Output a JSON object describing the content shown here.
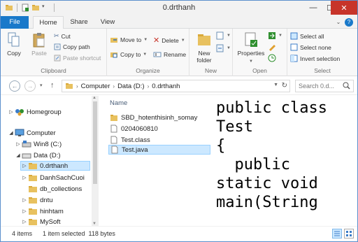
{
  "window": {
    "title": "0.drthanh"
  },
  "ribbon_tabs": [
    "File",
    "Home",
    "Share",
    "View"
  ],
  "clipboard": {
    "copy": "Copy",
    "paste": "Paste",
    "cut": "Cut",
    "copy_path": "Copy path",
    "paste_shortcut": "Paste shortcut",
    "label": "Clipboard"
  },
  "organize": {
    "move_to": "Move to",
    "copy_to": "Copy to",
    "delete": "Delete",
    "rename": "Rename",
    "label": "Organize"
  },
  "new_group": {
    "new_folder_line1": "New",
    "new_folder_line2": "folder",
    "label": "New"
  },
  "open_group": {
    "properties": "Properties",
    "label": "Open"
  },
  "select_group": {
    "select_all": "Select all",
    "select_none": "Select none",
    "invert_selection": "Invert selection",
    "label": "Select"
  },
  "address": {
    "crumbs": [
      "Computer",
      "Data (D:)",
      "0.drthanh"
    ],
    "search_placeholder": "Search 0.d..."
  },
  "nav_pane": {
    "items": [
      {
        "label": "Homegroup",
        "icon": "homegroup-icon",
        "arrow": "▷"
      },
      {
        "label": "Computer",
        "icon": "computer-icon",
        "arrow": "◢"
      },
      {
        "label": "Win8 (C:)",
        "icon": "drive-icon",
        "arrow": "▷"
      },
      {
        "label": "Data (D:)",
        "icon": "drive-icon",
        "arrow": "◢"
      },
      {
        "label": "0.drthanh",
        "icon": "folder-icon",
        "arrow": "▷"
      },
      {
        "label": "DanhSachCuoi",
        "icon": "folder-icon",
        "arrow": "▷"
      },
      {
        "label": "db_collections",
        "icon": "folder-icon",
        "arrow": ""
      },
      {
        "label": "dntu",
        "icon": "folder-icon",
        "arrow": "▷"
      },
      {
        "label": "hinhtam",
        "icon": "folder-icon",
        "arrow": "▷"
      },
      {
        "label": "MySoft",
        "icon": "folder-icon",
        "arrow": "▷"
      }
    ]
  },
  "file_list": {
    "column_name": "Name",
    "items": [
      {
        "name": "SBD_hotenthisinh_somay",
        "icon": "folder-icon"
      },
      {
        "name": "0204060810",
        "icon": "file-icon"
      },
      {
        "name": "Test.class",
        "icon": "file-icon"
      },
      {
        "name": "Test.java",
        "icon": "file-icon"
      }
    ]
  },
  "preview": {
    "lines": [
      "public class",
      "Test",
      "{",
      "  public",
      "static void",
      "main(String"
    ]
  },
  "status": {
    "count": "4 items",
    "selection": "1 item selected  118 bytes"
  },
  "colors": {
    "accent": "#1979ca",
    "selection_bg": "#cce8ff",
    "close_button": "#c7342a",
    "folder": "#e8c15f"
  }
}
